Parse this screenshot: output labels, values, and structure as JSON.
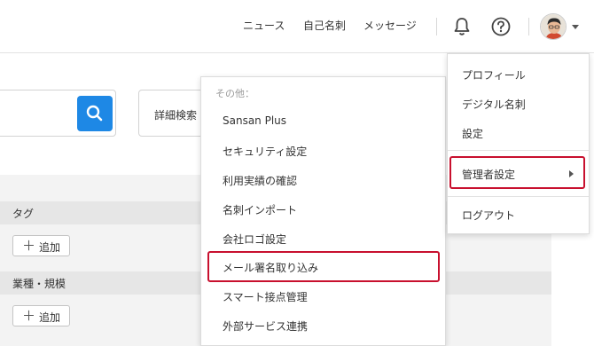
{
  "header": {
    "nav": [
      "ニュース",
      "自己名刺",
      "メッセージ"
    ]
  },
  "search": {
    "detail_label": "詳細検索"
  },
  "sections": [
    {
      "title": "タグ",
      "add_label": "追加"
    },
    {
      "title": "業種・規模",
      "add_label": "追加"
    }
  ],
  "others_menu": {
    "header": "その他：",
    "items": [
      "Sansan Plus",
      "セキュリティ設定",
      "利用実績の確認",
      "名刺インポート",
      "会社ロゴ設定",
      "メール署名取り込み",
      "スマート接点管理",
      "外部サービス連携"
    ],
    "highlighted_index": 5
  },
  "user_menu": {
    "items": [
      "プロフィール",
      "デジタル名刺",
      "設定",
      "管理者設定",
      "ログアウト"
    ],
    "highlighted_index": 3
  },
  "colors": {
    "accent_blue": "#1e88e5",
    "highlight_red": "#c8102e"
  }
}
